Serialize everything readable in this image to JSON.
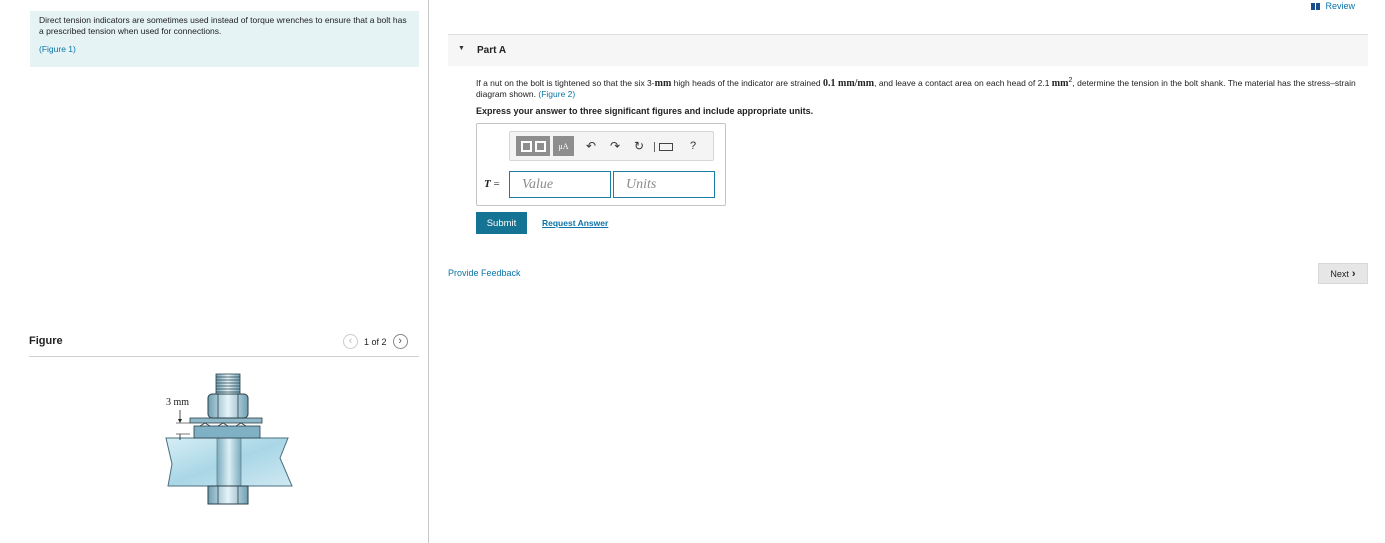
{
  "intro": {
    "text": "Direct tension indicators are sometimes used instead of torque wrenches to ensure that a bolt has a prescribed tension when used for connections.",
    "figure_link": "(Figure 1)"
  },
  "figure": {
    "title": "Figure",
    "pager": "1 of 2",
    "prev_icon": "chevron-left-icon",
    "next_icon": "chevron-right-icon",
    "dimension_label": "3 mm"
  },
  "review": {
    "label": "Review"
  },
  "part": {
    "title": "Part A",
    "question": {
      "p1": "If a nut on the bolt is tightened so that the six 3-",
      "m1": "mm",
      "p2": " high heads of the indicator are strained ",
      "m2": "0.1 mm/mm",
      "p3": ", and leave a contact area on each head of 2.1 ",
      "m3": "mm",
      "sup": "2",
      "p4": ", determine the tension in the bolt shank. The material has the stress–strain diagram shown. ",
      "link": "(Figure 2)"
    },
    "instruction": "Express your answer to three significant figures and include appropriate units."
  },
  "toolbar": {
    "templates_label": "",
    "mu_label": "μA",
    "undo_icon": "undo-icon",
    "redo_icon": "redo-icon",
    "reset_icon": "reset-icon",
    "keyboard_icon": "keyboard-icon",
    "help_label": "?"
  },
  "answer": {
    "variable": "T",
    "equals": " =",
    "value_placeholder": "Value",
    "units_placeholder": "Units"
  },
  "actions": {
    "submit": "Submit",
    "request_answer": "Request Answer",
    "provide_feedback": "Provide Feedback",
    "next": "Next"
  },
  "colors": {
    "accent": "#0a74a8",
    "submit_bg": "#157394",
    "intro_bg": "#e5f3f5"
  }
}
